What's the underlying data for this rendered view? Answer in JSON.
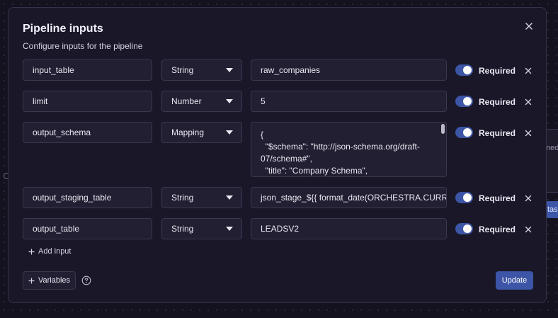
{
  "modal": {
    "title": "Pipeline inputs",
    "subtitle": "Configure inputs for the pipeline"
  },
  "inputs": [
    {
      "name": "input_table",
      "type": "String",
      "value": "raw_companies",
      "required": true,
      "required_label": "Required"
    },
    {
      "name": "limit",
      "type": "Number",
      "value": "5",
      "required": true,
      "required_label": "Required"
    },
    {
      "name": "output_schema",
      "type": "Mapping",
      "value": "{\n  \"$schema\": \"http://json-schema.org/draft-07/schema#\",\n  \"title\": \"Company Schema\",",
      "required": true,
      "required_label": "Required"
    },
    {
      "name": "output_staging_table",
      "type": "String",
      "value": "json_stage_${{ format_date(ORCHESTRA.CURRENT",
      "required": true,
      "required_label": "Required"
    },
    {
      "name": "output_table",
      "type": "String",
      "value": "LEADSV2",
      "required": true,
      "required_label": "Required"
    }
  ],
  "footer": {
    "add_input_label": "Add input",
    "variables_label": "Variables",
    "update_label": "Update"
  },
  "background": {
    "card_text": "ned",
    "button_text": "tas"
  },
  "colors": {
    "accent": "#3d55a6",
    "modal_bg": "#1a1828",
    "field_bg": "#211f31"
  },
  "icons": [
    "close-icon",
    "chevron-down-icon",
    "plus-icon",
    "help-icon"
  ]
}
